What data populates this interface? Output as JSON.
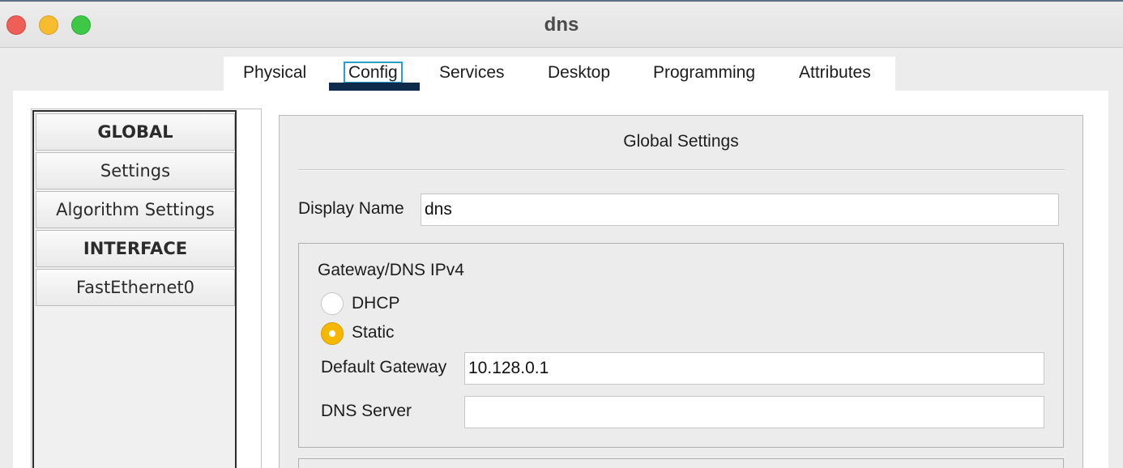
{
  "window": {
    "title": "dns"
  },
  "tabs": [
    {
      "label": "Physical",
      "active": false
    },
    {
      "label": "Config",
      "active": true
    },
    {
      "label": "Services",
      "active": false
    },
    {
      "label": "Desktop",
      "active": false
    },
    {
      "label": "Programming",
      "active": false
    },
    {
      "label": "Attributes",
      "active": false
    }
  ],
  "sidebar": {
    "items": [
      {
        "label": "GLOBAL",
        "header": true
      },
      {
        "label": "Settings",
        "header": false
      },
      {
        "label": "Algorithm Settings",
        "header": false
      },
      {
        "label": "INTERFACE",
        "header": true
      },
      {
        "label": "FastEthernet0",
        "header": false
      }
    ]
  },
  "global_settings": {
    "title": "Global Settings",
    "display_name_label": "Display Name",
    "display_name_value": "dns",
    "gateway_group": {
      "title": "Gateway/DNS IPv4",
      "dhcp_label": "DHCP",
      "static_label": "Static",
      "selected": "Static",
      "default_gateway_label": "Default Gateway",
      "default_gateway_value": "10.128.0.1",
      "dns_server_label": "DNS Server",
      "dns_server_value": ""
    }
  },
  "colors": {
    "active_tab_underline": "#0f2b4b",
    "radio_selected": "#f5b700",
    "close": "#ee5f58",
    "minimize": "#f8bd2f",
    "zoom": "#3ec845"
  }
}
